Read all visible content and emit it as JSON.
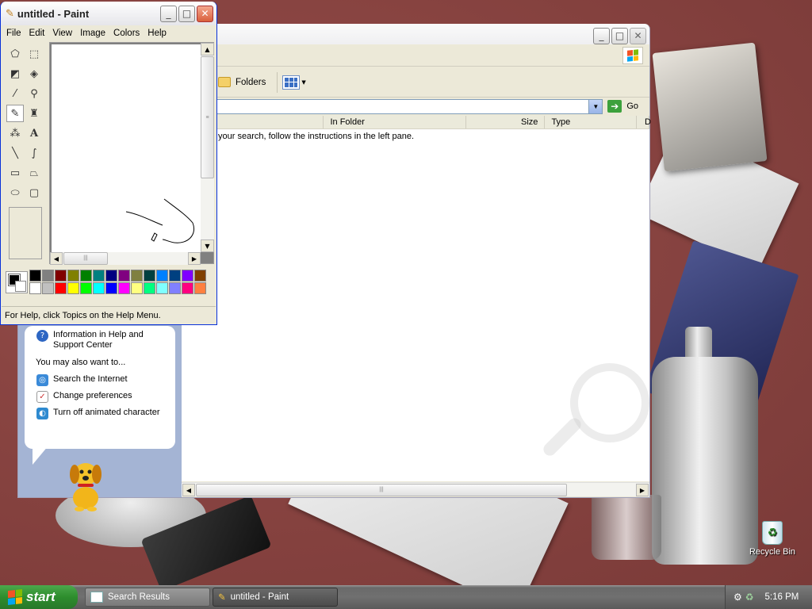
{
  "paint": {
    "title": "untitled - Paint",
    "menu": [
      "File",
      "Edit",
      "View",
      "Image",
      "Colors",
      "Help"
    ],
    "status": "For Help, click Topics on the Help Menu.",
    "tools": [
      "free-form-select",
      "select",
      "eraser",
      "fill",
      "pick-color",
      "magnifier",
      "pencil",
      "brush",
      "airbrush",
      "text",
      "line",
      "curve",
      "rectangle",
      "polygon",
      "ellipse",
      "rounded-rectangle"
    ],
    "palette_row1": [
      "#000000",
      "#808080",
      "#800000",
      "#808000",
      "#008000",
      "#008080",
      "#000080",
      "#800080",
      "#808040",
      "#004040",
      "#0080ff",
      "#004080",
      "#8000ff",
      "#804000"
    ],
    "palette_row2": [
      "#ffffff",
      "#c0c0c0",
      "#ff0000",
      "#ffff00",
      "#00ff00",
      "#00ffff",
      "#0000ff",
      "#ff00ff",
      "#ffff80",
      "#00ff80",
      "#80ffff",
      "#8080ff",
      "#ff0080",
      "#ff8040"
    ]
  },
  "explorer": {
    "toolbar": {
      "folders_label": "Folders"
    },
    "go_label": "Go",
    "columns": [
      "In Folder",
      "Size",
      "Type",
      "D"
    ],
    "message": "your search, follow the instructions in the left pane.",
    "assistant": {
      "help_item": "Information in Help and Support Center",
      "also_label": "You may also want to...",
      "items": [
        "Search the Internet",
        "Change preferences",
        "Turn off animated character"
      ]
    }
  },
  "taskbar": {
    "start_label": "start",
    "items": [
      "Search Results",
      "untitled - Paint"
    ],
    "clock": "5:16 PM"
  },
  "desktop": {
    "recycle_bin_label": "Recycle Bin"
  }
}
